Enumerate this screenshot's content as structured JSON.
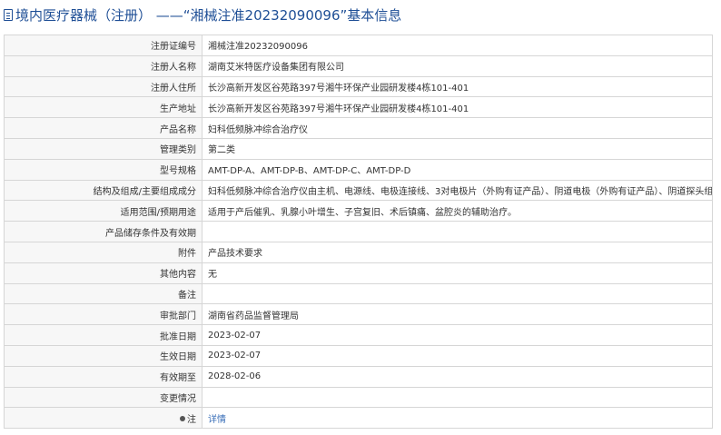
{
  "header": {
    "title": "境内医疗器械（注册） ——“湘械注准20232090096”基本信息"
  },
  "rows": [
    {
      "label": "注册证编号",
      "value": "湘械注准20232090096"
    },
    {
      "label": "注册人名称",
      "value": "湖南艾米特医疗设备集团有限公司"
    },
    {
      "label": "注册人住所",
      "value": "长沙高新开发区谷苑路397号湘牛环保产业园研发楼4栋101-401"
    },
    {
      "label": "生产地址",
      "value": "长沙高新开发区谷苑路397号湘牛环保产业园研发楼4栋101-401"
    },
    {
      "label": "产品名称",
      "value": "妇科低频脉冲综合治疗仪"
    },
    {
      "label": "管理类别",
      "value": "第二类"
    },
    {
      "label": "型号规格",
      "value": "AMT-DP-A、AMT-DP-B、AMT-DP-C、AMT-DP-D"
    },
    {
      "label": "结构及组成/主要组成成分",
      "value": "妇科低频脉冲综合治疗仪由主机、电源线、电极连接线、3对电极片（外购有证产品）、阴道电极（外购有证产品）、阴道探头组成。"
    },
    {
      "label": "适用范围/预期用途",
      "value": "适用于产后催乳、乳腺小叶增生、子宫复旧、术后镇痛、盆腔炎的辅助治疗。"
    },
    {
      "label": "产品储存条件及有效期",
      "value": ""
    },
    {
      "label": "附件",
      "value": "产品技术要求"
    },
    {
      "label": "其他内容",
      "value": "无"
    },
    {
      "label": "备注",
      "value": ""
    },
    {
      "label": "审批部门",
      "value": "湖南省药品监督管理局"
    },
    {
      "label": "批准日期",
      "value": "2023-02-07"
    },
    {
      "label": "生效日期",
      "value": "2023-02-07"
    },
    {
      "label": "有效期至",
      "value": "2028-02-06"
    },
    {
      "label": "变更情况",
      "value": ""
    }
  ],
  "note_row": {
    "label": "注",
    "link": "详情"
  },
  "colors": {
    "header_text": "#1f4f96",
    "label_bg": "#f7f7f7",
    "border": "#d6d6d6",
    "link": "#3a6fb8"
  }
}
